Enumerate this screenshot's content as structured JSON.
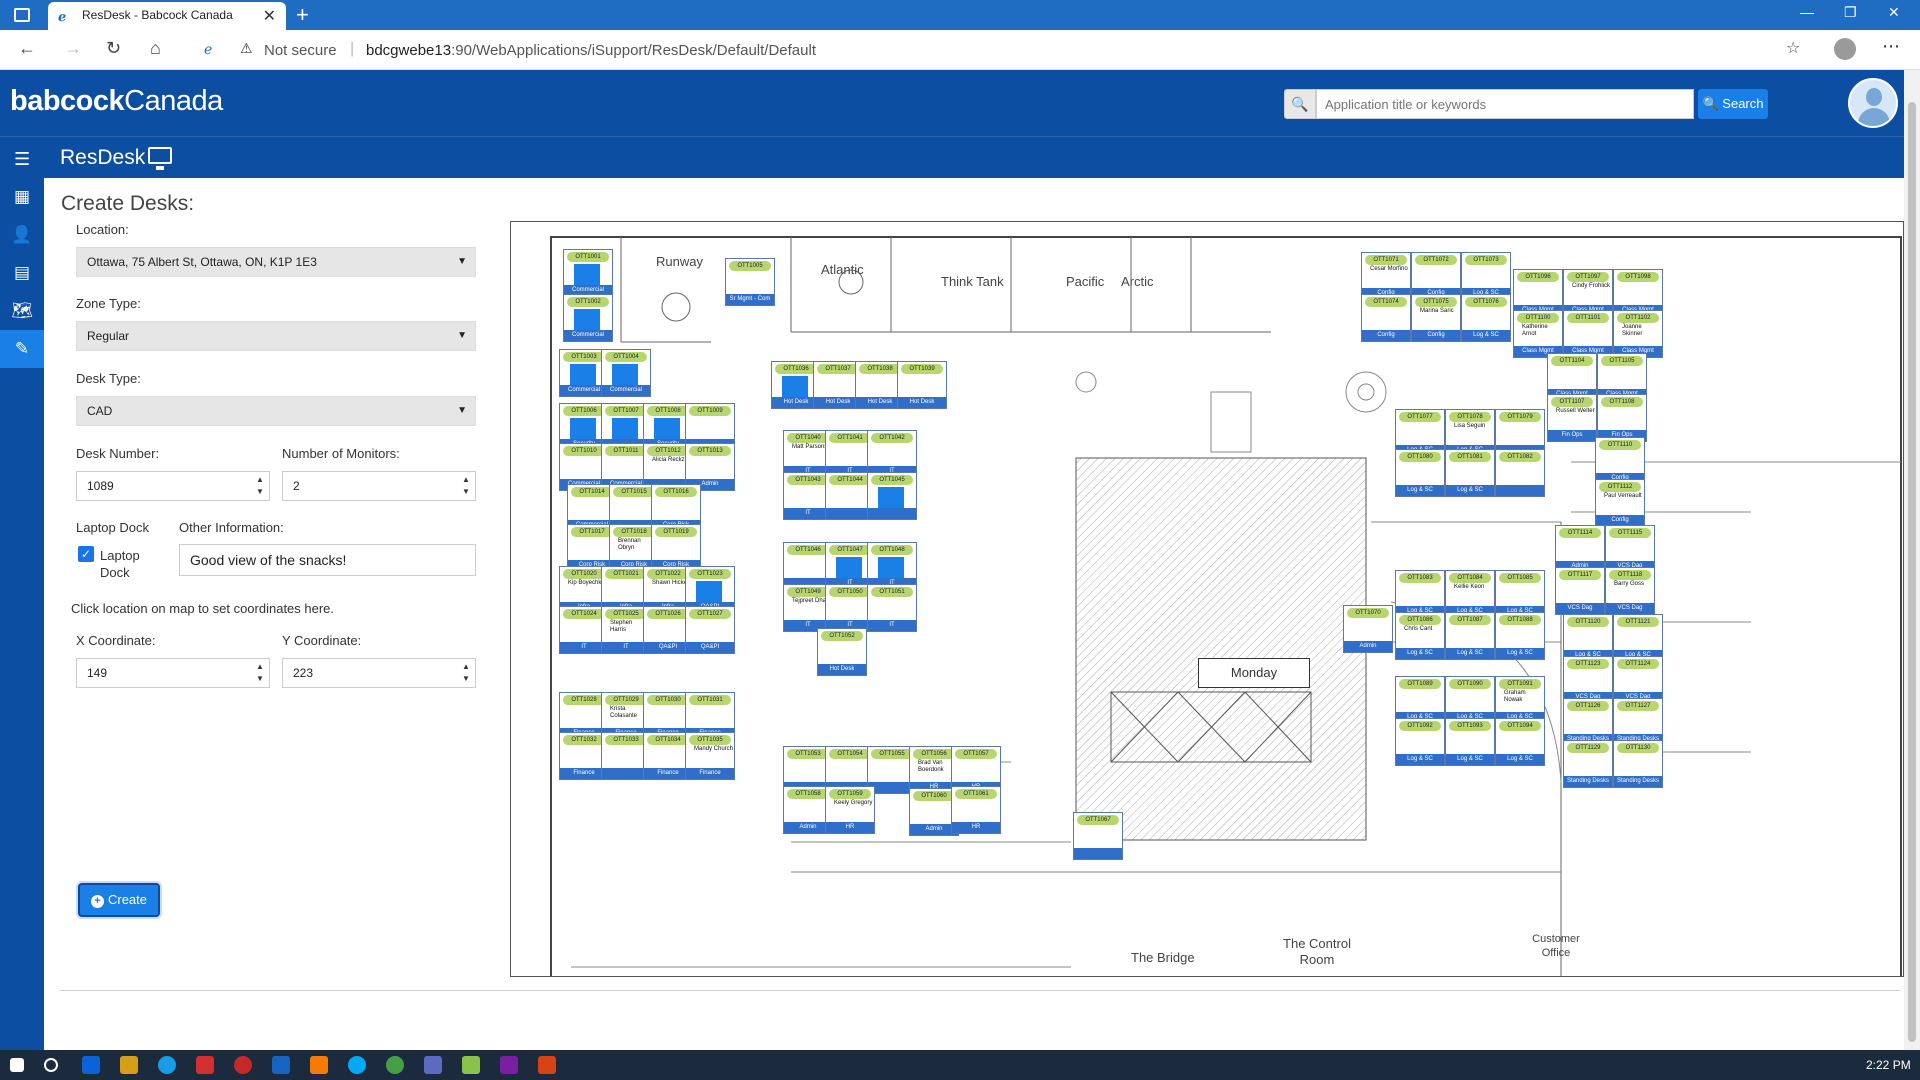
{
  "browser": {
    "tab_title": "ResDesk - Babcock Canada",
    "not_secure": "Not secure",
    "url_host": "bdcgwebe13",
    "url_path": ":90/WebApplications/iSupport/ResDesk/Default/Default"
  },
  "header": {
    "brand_bold": "babcock",
    "brand_light": "Canada",
    "search_placeholder": "Application title or keywords",
    "search_button": "Search",
    "app_title": "ResDesk"
  },
  "form": {
    "title": "Create Desks:",
    "location_label": "Location:",
    "location_value": "Ottawa, 75 Albert St, Ottawa, ON, K1P 1E3",
    "zone_label": "Zone Type:",
    "zone_value": "Regular",
    "desk_type_label": "Desk Type:",
    "desk_type_value": "CAD",
    "desk_number_label": "Desk Number:",
    "desk_number_value": "1089",
    "monitors_label": "Number of Monitors:",
    "monitors_value": "2",
    "laptop_dock_label": "Laptop Dock",
    "laptop_dock_checkbox_label": "Laptop Dock",
    "laptop_dock_checked": true,
    "other_info_label": "Other Information:",
    "other_info_value": "Good view of the snacks!",
    "coord_hint": "Click location on map to set coordinates here.",
    "x_label": "X Coordinate:",
    "x_value": "149",
    "y_label": "Y Coordinate:",
    "y_value": "223",
    "create_button": "Create"
  },
  "map": {
    "rooms": [
      "Runway",
      "Atlantic",
      "Think Tank",
      "Pacific",
      "Arctic",
      "Monday",
      "The Bridge",
      "The Control Room",
      "Customer Office"
    ],
    "desks": [
      {
        "id": "OTT1001",
        "dept": "Commercial",
        "occupied": true
      },
      {
        "id": "OTT1002",
        "dept": "Commercial",
        "occupied": true
      },
      {
        "id": "OTT1003",
        "dept": "Commercial",
        "occupied": true
      },
      {
        "id": "OTT1004",
        "dept": "Commercial",
        "occupied": true
      },
      {
        "id": "OTT1005",
        "dept": "Sr Mgmt - Com",
        "occupied": false
      },
      {
        "id": "OTT1006",
        "dept": "Security",
        "occupied": true
      },
      {
        "id": "OTT1007",
        "dept": "",
        "occupied": true
      },
      {
        "id": "OTT1008",
        "dept": "Security",
        "occupied": true
      },
      {
        "id": "OTT1009",
        "dept": "",
        "occupied": false
      },
      {
        "id": "OTT1010",
        "dept": "Commercial",
        "occupied": false
      },
      {
        "id": "OTT1011",
        "dept": "Commercial",
        "occupied": false
      },
      {
        "id": "OTT1012",
        "dept": "",
        "name": "Alicia Reckzin",
        "occupied": false
      },
      {
        "id": "OTT1013",
        "dept": "Admin",
        "occupied": false
      },
      {
        "id": "OTT1014",
        "dept": "Commercial",
        "occupied": false
      },
      {
        "id": "OTT1015",
        "dept": "",
        "occupied": false
      },
      {
        "id": "OTT1016",
        "dept": "Corp Risk",
        "occupied": false
      },
      {
        "id": "OTT1017",
        "dept": "Corp Risk",
        "occupied": false
      },
      {
        "id": "OTT1018",
        "dept": "Corp Risk",
        "name": "Brennan Obryn",
        "occupied": false
      },
      {
        "id": "OTT1019",
        "dept": "Corp Risk",
        "occupied": false
      },
      {
        "id": "OTT1020",
        "dept": "Infra",
        "name": "Kip Boyechko",
        "occupied": false
      },
      {
        "id": "OTT1021",
        "dept": "Infra",
        "occupied": false
      },
      {
        "id": "OTT1022",
        "dept": "Infra",
        "name": "Shawn Hickey",
        "occupied": false
      },
      {
        "id": "OTT1023",
        "dept": "QA&PI",
        "occupied": true
      },
      {
        "id": "OTT1024",
        "dept": "IT",
        "occupied": false
      },
      {
        "id": "OTT1025",
        "dept": "IT",
        "name": "Stephen Harris",
        "occupied": false
      },
      {
        "id": "OTT1026",
        "dept": "QA&PI",
        "occupied": false
      },
      {
        "id": "OTT1027",
        "dept": "QA&PI",
        "occupied": false
      },
      {
        "id": "OTT1028",
        "dept": "Finance",
        "occupied": false
      },
      {
        "id": "OTT1029",
        "dept": "Finance",
        "name": "Krista Colasante",
        "occupied": false
      },
      {
        "id": "OTT1030",
        "dept": "Finance",
        "occupied": false
      },
      {
        "id": "OTT1031",
        "dept": "Finance",
        "occupied": false
      },
      {
        "id": "OTT1032",
        "dept": "Finance",
        "occupied": false
      },
      {
        "id": "OTT1033",
        "dept": "",
        "occupied": false
      },
      {
        "id": "OTT1034",
        "dept": "Finance",
        "occupied": false
      },
      {
        "id": "OTT1035",
        "dept": "Finance",
        "name": "Mandy Church",
        "occupied": false
      },
      {
        "id": "OTT1036",
        "dept": "Hot Desk",
        "occupied": true
      },
      {
        "id": "OTT1037",
        "dept": "Hot Desk",
        "occupied": false
      },
      {
        "id": "OTT1038",
        "dept": "Hot Desk",
        "occupied": false
      },
      {
        "id": "OTT1039",
        "dept": "Hot Desk",
        "occupied": false
      },
      {
        "id": "OTT1040",
        "dept": "IT",
        "name": "Matt Parsons",
        "occupied": false
      },
      {
        "id": "OTT1041",
        "dept": "IT",
        "occupied": false
      },
      {
        "id": "OTT1042",
        "dept": "IT",
        "occupied": false
      },
      {
        "id": "OTT1043",
        "dept": "IT",
        "occupied": false
      },
      {
        "id": "OTT1044",
        "dept": "",
        "occupied": false
      },
      {
        "id": "OTT1045",
        "dept": "",
        "occupied": true
      },
      {
        "id": "OTT1046",
        "dept": "",
        "occupied": false
      },
      {
        "id": "OTT1047",
        "dept": "IT",
        "occupied": true
      },
      {
        "id": "OTT1048",
        "dept": "IT",
        "occupied": true
      },
      {
        "id": "OTT1049",
        "dept": "IT",
        "name": "Tejpreet Dhatt",
        "occupied": false
      },
      {
        "id": "OTT1050",
        "dept": "IT",
        "occupied": false
      },
      {
        "id": "OTT1051",
        "dept": "IT",
        "occupied": false
      },
      {
        "id": "OTT1052",
        "dept": "Hot Desk",
        "occupied": false
      },
      {
        "id": "OTT1053",
        "dept": "",
        "occupied": false
      },
      {
        "id": "OTT1054",
        "dept": "",
        "occupied": false
      },
      {
        "id": "OTT1055",
        "dept": "",
        "occupied": false
      },
      {
        "id": "OTT1056",
        "dept": "HR",
        "name": "Brad Van Boerdonk",
        "occupied": false
      },
      {
        "id": "OTT1057",
        "dept": "HR",
        "occupied": false
      },
      {
        "id": "OTT1058",
        "dept": "Admin",
        "occupied": false
      },
      {
        "id": "OTT1059",
        "dept": "HR",
        "name": "Keely Gregory",
        "occupied": false
      },
      {
        "id": "OTT1060",
        "dept": "Admin",
        "occupied": false
      },
      {
        "id": "OTT1061",
        "dept": "HR",
        "occupied": false
      },
      {
        "id": "OTT1067",
        "dept": "",
        "occupied": false
      },
      {
        "id": "OTT1070",
        "dept": "Admin",
        "occupied": false
      },
      {
        "id": "OTT1071",
        "dept": "Config",
        "name": "Cesar Morfino",
        "occupied": false
      },
      {
        "id": "OTT1072",
        "dept": "Config",
        "occupied": false
      },
      {
        "id": "OTT1073",
        "dept": "Log & SC",
        "occupied": false
      },
      {
        "id": "OTT1074",
        "dept": "Config",
        "occupied": false
      },
      {
        "id": "OTT1075",
        "dept": "Config",
        "name": "Marina Saric",
        "occupied": false
      },
      {
        "id": "OTT1076",
        "dept": "Log & SC",
        "occupied": false
      },
      {
        "id": "OTT1077",
        "dept": "Log & SC",
        "occupied": false
      },
      {
        "id": "OTT1078",
        "dept": "Log & SC",
        "name": "Lisa Seguin",
        "occupied": false
      },
      {
        "id": "OTT1079",
        "dept": "",
        "occupied": false
      },
      {
        "id": "OTT1080",
        "dept": "Log & SC",
        "occupied": false
      },
      {
        "id": "OTT1081",
        "dept": "Log & SC",
        "occupied": false
      },
      {
        "id": "OTT1082",
        "dept": "",
        "occupied": false
      },
      {
        "id": "OTT1083",
        "dept": "Log & SC",
        "occupied": false
      },
      {
        "id": "OTT1084",
        "dept": "Log & SC",
        "name": "Kellie Keon",
        "occupied": false
      },
      {
        "id": "OTT1085",
        "dept": "Log & SC",
        "occupied": false
      },
      {
        "id": "OTT1086",
        "dept": "Log & SC",
        "name": "Chris Cant",
        "occupied": false
      },
      {
        "id": "OTT1087",
        "dept": "Log & SC",
        "occupied": false
      },
      {
        "id": "OTT1088",
        "dept": "Log & SC",
        "occupied": false
      },
      {
        "id": "OTT1089",
        "dept": "Log & SC",
        "occupied": false
      },
      {
        "id": "OTT1090",
        "dept": "Log & SC",
        "occupied": false
      },
      {
        "id": "OTT1091",
        "dept": "Log & SC",
        "name": "Graham Nowak",
        "occupied": false
      },
      {
        "id": "OTT1092",
        "dept": "Log & SC",
        "occupied": false
      },
      {
        "id": "OTT1093",
        "dept": "Log & SC",
        "occupied": false
      },
      {
        "id": "OTT1094",
        "dept": "Log & SC",
        "occupied": false
      },
      {
        "id": "OTT1096",
        "dept": "Class Mgmt",
        "occupied": false
      },
      {
        "id": "OTT1097",
        "dept": "Class Mgmt",
        "name": "Cindy Frohlick",
        "occupied": false
      },
      {
        "id": "OTT1098",
        "dept": "Class Mgmt",
        "occupied": false
      },
      {
        "id": "OTT1100",
        "dept": "Class Mgmt",
        "name": "Katherine Arnot",
        "occupied": false
      },
      {
        "id": "OTT1101",
        "dept": "Class Mgmt",
        "occupied": false
      },
      {
        "id": "OTT1102",
        "dept": "Class Mgmt",
        "name": "Joanne Skinner",
        "occupied": false
      },
      {
        "id": "OTT1104",
        "dept": "Class Mgmt",
        "occupied": false
      },
      {
        "id": "OTT1105",
        "dept": "Class Mgmt",
        "occupied": false
      },
      {
        "id": "OTT1107",
        "dept": "Fin Ops",
        "name": "Russell Welter",
        "occupied": false
      },
      {
        "id": "OTT1108",
        "dept": "Fin Ops",
        "occupied": false
      },
      {
        "id": "OTT1110",
        "dept": "Config",
        "occupied": false
      },
      {
        "id": "OTT1112",
        "dept": "Config",
        "name": "Paul Verreault",
        "occupied": false
      },
      {
        "id": "OTT1114",
        "dept": "Admin",
        "occupied": false
      },
      {
        "id": "OTT1115",
        "dept": "VCS Dag",
        "occupied": false
      },
      {
        "id": "OTT1117",
        "dept": "VCS Dag",
        "occupied": false
      },
      {
        "id": "OTT1118",
        "dept": "VCS Dag",
        "name": "Barry Goss",
        "occupied": false
      },
      {
        "id": "OTT1120",
        "dept": "Log & SC",
        "occupied": false
      },
      {
        "id": "OTT1121",
        "dept": "Log & SC",
        "occupied": false
      },
      {
        "id": "OTT1123",
        "dept": "VCS Dag",
        "occupied": false
      },
      {
        "id": "OTT1124",
        "dept": "VCS Dag",
        "occupied": false
      },
      {
        "id": "OTT1126",
        "dept": "Standing Desks",
        "occupied": false
      },
      {
        "id": "OTT1127",
        "dept": "Standing Desks",
        "occupied": false
      },
      {
        "id": "OTT1129",
        "dept": "Standing Desks",
        "occupied": false
      },
      {
        "id": "OTT1130",
        "dept": "Standing Desks",
        "occupied": false
      }
    ]
  },
  "taskbar": {
    "clock": "2:22 PM"
  }
}
